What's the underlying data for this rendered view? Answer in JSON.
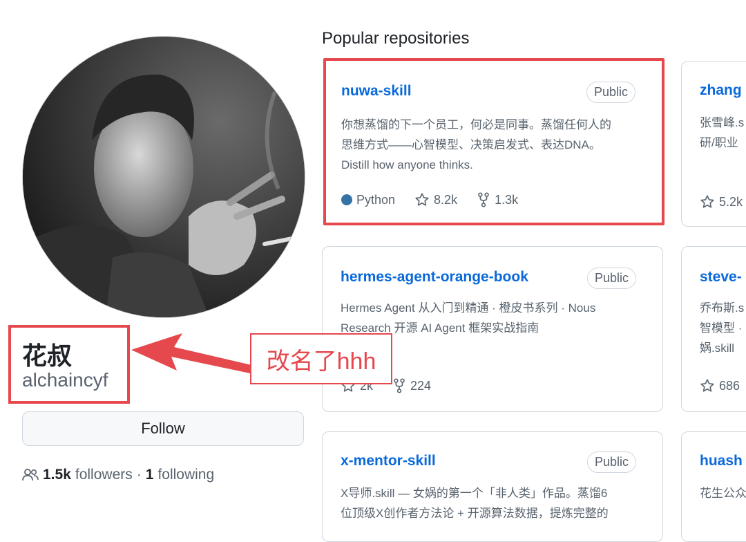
{
  "profile": {
    "display_name": "花叔",
    "username": "alchaincyf",
    "follow_label": "Follow",
    "followers_count": "1.5k",
    "followers_label": "followers",
    "separator": "·",
    "following_count": "1",
    "following_label": "following"
  },
  "annotation": {
    "note": "改名了hhh",
    "color": "#e5484d"
  },
  "section_title": "Popular repositories",
  "repos": [
    {
      "name": "nuwa-skill",
      "visibility": "Public",
      "desc_line1": "你想蒸馏的下一个员工，何必是同事。蒸馏任何人的",
      "desc_line2": "思维方式——心智模型、决策启发式、表达DNA。",
      "desc_line3": "Distill how anyone thinks.",
      "language": "Python",
      "language_color": "#3572A5",
      "stars": "8.2k",
      "forks": "1.3k"
    },
    {
      "name": "hermes-agent-orange-book",
      "visibility": "Public",
      "desc_line1": "Hermes Agent 从入门到精通 · 橙皮书系列 · Nous",
      "desc_line2": "Research 开源 AI Agent 框架实战指南",
      "stars": "2k",
      "forks": "224"
    },
    {
      "name": "x-mentor-skill",
      "visibility": "Public",
      "desc_line1": "X导师.skill — 女娲的第一个「非人类」作品。蒸馏6",
      "desc_line2": "位顶级X创作者方法论 + 开源算法数据，提炼完整的"
    }
  ],
  "side_repos": [
    {
      "name": "zhang",
      "desc_line1": "张雪峰.s",
      "desc_line2": "研/职业",
      "stars": "5.2k"
    },
    {
      "name": "steve-",
      "desc_line1": "乔布斯.s",
      "desc_line2": "智模型 ·",
      "desc_line3": "娲.skill",
      "stars": "686"
    },
    {
      "name": "huash",
      "desc_line1": "花生公众"
    }
  ]
}
